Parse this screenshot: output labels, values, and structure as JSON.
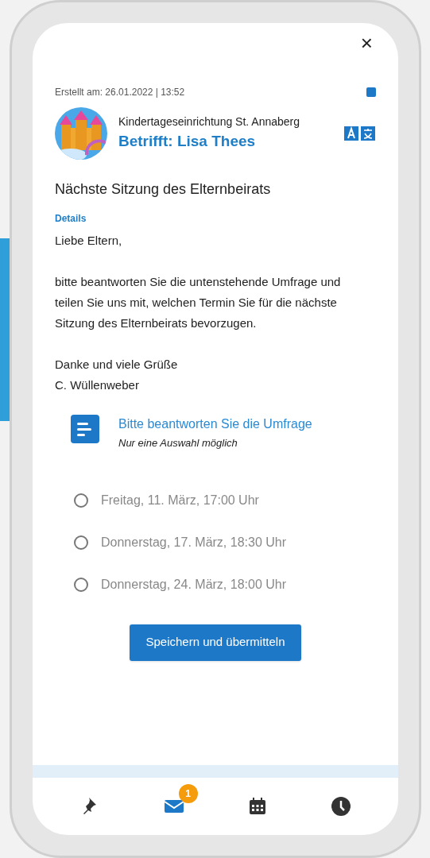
{
  "close_label": "×",
  "created": "Erstellt am: 26.01.2022 | 13:52",
  "sender": "Kindertageseinrichtung St. Annaberg",
  "subject": "Betrifft: Lisa Thees",
  "title": "Nächste Sitzung des Elternbeirats",
  "details_label": "Details",
  "body": [
    "Liebe Eltern,",
    "bitte beantworten Sie die untenstehende Umfrage und teilen Sie uns mit, welchen Termin Sie für die nächste Sitzung des Elternbeirats bevorzugen.",
    "Danke und viele Grüße\nC. Wüllenweber"
  ],
  "survey": {
    "prompt": "Bitte beantworten Sie die Umfrage",
    "hint": "Nur eine Auswahl möglich",
    "options": [
      {
        "label": "Freitag, 11. März, 17:00 Uhr",
        "checked": false
      },
      {
        "label": "Donnerstag, 17. März, 18:30 Uhr",
        "checked": false
      },
      {
        "label": "Donnerstag, 24. März, 18:00 Uhr",
        "checked": false
      }
    ],
    "submit": "Speichern und übermitteln"
  },
  "nav": [
    {
      "kind": "pin",
      "selected": false
    },
    {
      "kind": "mail",
      "selected": true,
      "badge": "1"
    },
    {
      "kind": "calendar",
      "selected": false
    },
    {
      "kind": "clock",
      "selected": false
    }
  ]
}
